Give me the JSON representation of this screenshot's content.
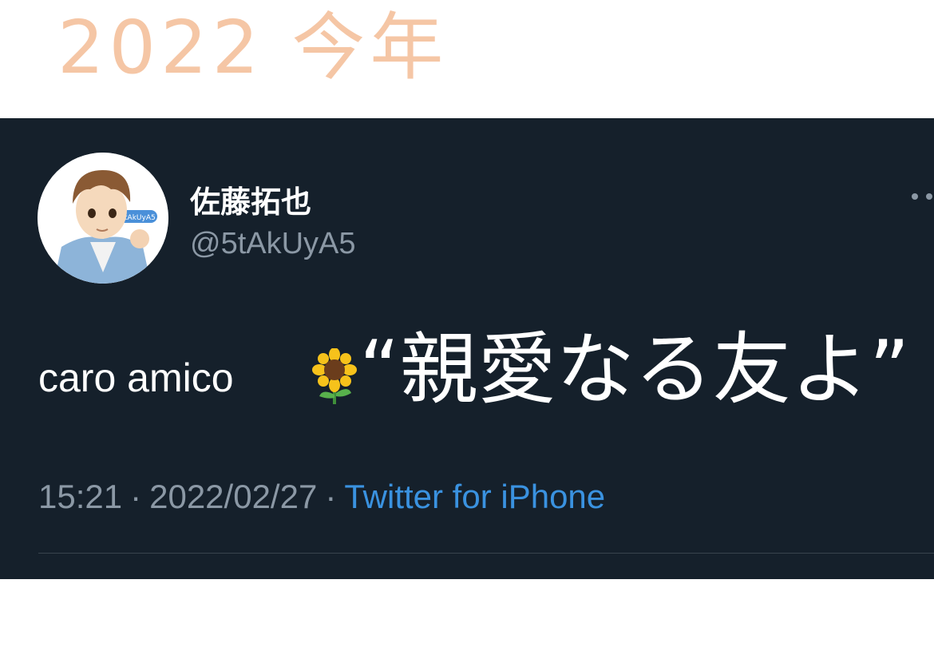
{
  "annotation": {
    "top_text": "2022 今年",
    "top_color": "#f5c6a5",
    "caption": "“親愛なる友よ”"
  },
  "tweet": {
    "display_name": "佐藤拓也",
    "handle": "@5tAkUyA5",
    "avatar_badge": "@5tAkUyA5",
    "text": "caro amico",
    "emoji": "sunflower",
    "time": "15:21",
    "date": "2022/02/27",
    "separator": "·",
    "source": "Twitter for iPhone"
  },
  "icons": {
    "more": "more-options-icon",
    "emoji": "sunflower-icon"
  },
  "colors": {
    "background": "#15202b",
    "secondary_text": "#8b98a5",
    "link": "#3a92e0",
    "divider": "#38444d"
  }
}
